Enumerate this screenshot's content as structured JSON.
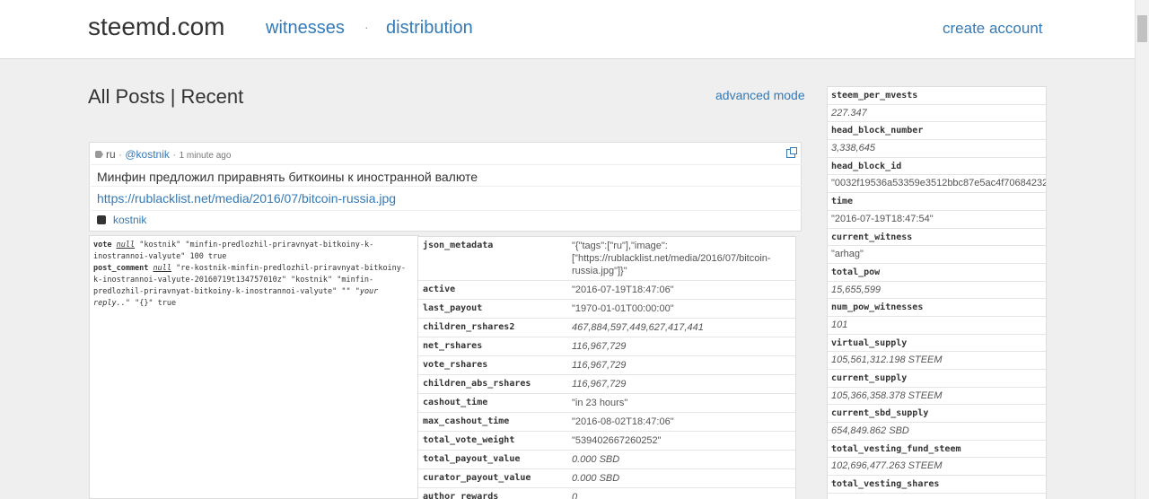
{
  "header": {
    "brand": "steemd.com",
    "nav": [
      "witnesses",
      "distribution"
    ],
    "separator": "·",
    "create_account": "create account"
  },
  "page": {
    "title": "All Posts | Recent",
    "advanced_mode": "advanced mode"
  },
  "post": {
    "tag": "ru",
    "author_handle": "@kostnik",
    "time": "1 minute ago",
    "title": "Минфин предложил приравнять биткоины к иностранной валюте",
    "link": "https://rublacklist.net/media/2016/07/bitcoin-russia.jpg",
    "voter": "kostnik"
  },
  "ops": {
    "vote_key": "vote",
    "vote_null": "null",
    "vote_rest": "\"kostnik\" \"minfin-predlozhil-priravnyat-bitkoiny-k-inostrannoi-valyute\" 100 true",
    "comment_key": "post_comment",
    "comment_null": "null",
    "comment_rest": "\"re-kostnik-minfin-predlozhil-priravnyat-bitkoiny-k-inostrannoi-valyute-20160719t134757010z\" \"kostnik\" \"minfin-predlozhil-priravnyat-bitkoiny-k-inostrannoi-valyute\" \"\"",
    "comment_reply": "\"your reply..\"",
    "comment_tail": "\"{}\" true"
  },
  "details": [
    {
      "key": "json_metadata",
      "value": "\"{\"tags\":[\"ru\"],\"image\":[\"https://rublacklist.net/media/2016/07/bitcoin-russia.jpg\"]}\"",
      "italic": false
    },
    {
      "key": "active",
      "value": "\"2016-07-19T18:47:06\"",
      "italic": false
    },
    {
      "key": "last_payout",
      "value": "\"1970-01-01T00:00:00\"",
      "italic": false
    },
    {
      "key": "children_rshares2",
      "value": "467,884,597,449,627,417,441",
      "italic": true
    },
    {
      "key": "net_rshares",
      "value": "116,967,729",
      "italic": true
    },
    {
      "key": "vote_rshares",
      "value": "116,967,729",
      "italic": true
    },
    {
      "key": "children_abs_rshares",
      "value": "116,967,729",
      "italic": true
    },
    {
      "key": "cashout_time",
      "value": "\"in 23 hours\"",
      "italic": false
    },
    {
      "key": "max_cashout_time",
      "value": "\"2016-08-02T18:47:06\"",
      "italic": false
    },
    {
      "key": "total_vote_weight",
      "value": "\"539402667260252\"",
      "italic": false
    },
    {
      "key": "total_payout_value",
      "value": "0.000 SBD",
      "italic": true
    },
    {
      "key": "curator_payout_value",
      "value": "0.000 SBD",
      "italic": true
    },
    {
      "key": "author_rewards",
      "value": "0",
      "italic": true
    }
  ],
  "sidebar": [
    {
      "key": "steem_per_mvests",
      "value": "227.347",
      "italic": true
    },
    {
      "key": "head_block_number",
      "value": "3,338,645",
      "italic": true
    },
    {
      "key": "head_block_id",
      "value": "\"0032f19536a53359e3512bbc87e5ac4f70684232\"",
      "italic": false
    },
    {
      "key": "time",
      "value": "\"2016-07-19T18:47:54\"",
      "italic": false
    },
    {
      "key": "current_witness",
      "value": "\"arhag\"",
      "italic": false
    },
    {
      "key": "total_pow",
      "value": "15,655,599",
      "italic": true
    },
    {
      "key": "num_pow_witnesses",
      "value": "101",
      "italic": true
    },
    {
      "key": "virtual_supply",
      "value": "105,561,312.198 STEEM",
      "italic": true
    },
    {
      "key": "current_supply",
      "value": "105,366,358.378 STEEM",
      "italic": true
    },
    {
      "key": "current_sbd_supply",
      "value": "654,849.862 SBD",
      "italic": true
    },
    {
      "key": "total_vesting_fund_steem",
      "value": "102,696,477.263 STEEM",
      "italic": true
    },
    {
      "key": "total_vesting_shares",
      "value": "",
      "italic": true
    }
  ]
}
